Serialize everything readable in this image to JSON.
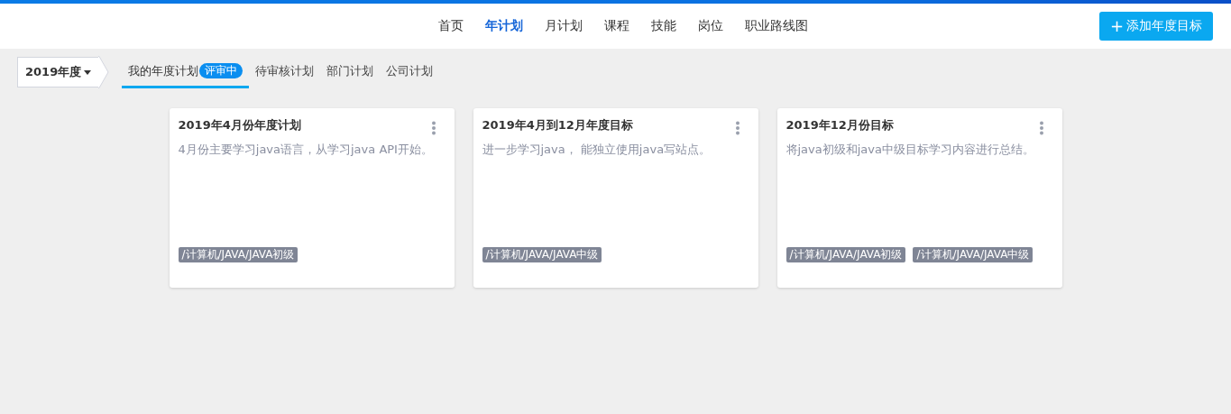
{
  "nav": {
    "items": [
      {
        "label": "首页",
        "selected": false
      },
      {
        "label": "年计划",
        "selected": true
      },
      {
        "label": "月计划",
        "selected": false
      },
      {
        "label": "课程",
        "selected": false
      },
      {
        "label": "技能",
        "selected": false
      },
      {
        "label": "岗位",
        "selected": false
      },
      {
        "label": "职业路线图",
        "selected": false
      }
    ],
    "add_button": {
      "icon": "+",
      "label": "添加年度目标"
    }
  },
  "year_select": {
    "value": "2019年度"
  },
  "tabs": [
    {
      "label": "我的年度计划",
      "badge": "评审中",
      "selected": true
    },
    {
      "label": "待审核计划",
      "selected": false
    },
    {
      "label": "部门计划",
      "selected": false
    },
    {
      "label": "公司计划",
      "selected": false
    }
  ],
  "cards": [
    {
      "title": "2019年4月份年度计划",
      "description": "4月份主要学习java语言，从学习java API开始。",
      "tags": [
        "/计算机/JAVA/JAVA初级"
      ]
    },
    {
      "title": "2019年4月到12月年度目标",
      "description": "进一步学习java， 能独立使用java写站点。",
      "tags": [
        "/计算机/JAVA/JAVA中级"
      ]
    },
    {
      "title": "2019年12月份目标",
      "description": "将java初级和java中级目标学习内容进行总结。",
      "tags": [
        "/计算机/JAVA/JAVA初级",
        "/计算机/JAVA/JAVA中级"
      ]
    }
  ]
}
